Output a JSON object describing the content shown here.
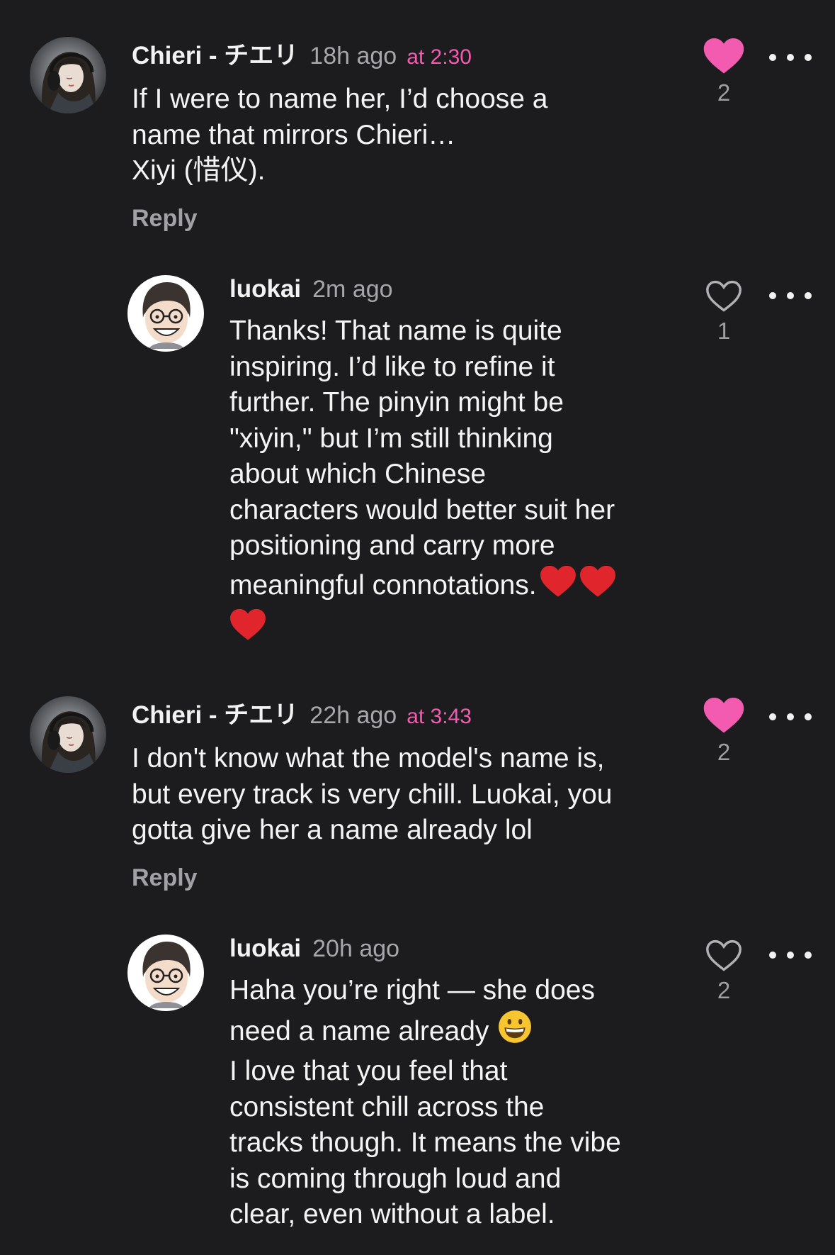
{
  "colors": {
    "background": "#1c1c1e",
    "accent_pink": "#f25bb0",
    "muted_text": "#a7a7ab"
  },
  "comments": [
    {
      "author": "Chieri - チエリ",
      "time": "18h ago",
      "timestamp_link": "at 2:30",
      "text": "If I were to name her, I’d choose a\nname that mirrors Chieri…\nXiyi (惜仪).",
      "reply_label": "Reply",
      "likes": "2",
      "liked": true,
      "avatar_icon": "headphones-girl-avatar-icon"
    },
    {
      "author": "luokai",
      "time": "2m ago",
      "text": "Thanks! That name is quite\ninspiring. I’d like to refine it\nfurther. The pinyin might be\n\"xiyin,\" but I’m still thinking\nabout which Chinese\ncharacters would better suit her\npositioning and carry more\nmeaningful connotations.",
      "likes": "1",
      "liked": false,
      "emoji": "red-heart-emoji",
      "avatar_icon": "cartoon-man-glasses-avatar-icon"
    },
    {
      "author": "Chieri - チエリ",
      "time": "22h ago",
      "timestamp_link": "at 3:43",
      "text": "I don't know what the model's name is,\nbut every track is very chill. Luokai, you\ngotta give her a name already lol",
      "reply_label": "Reply",
      "likes": "2",
      "liked": true,
      "avatar_icon": "headphones-girl-avatar-icon"
    },
    {
      "author": "luokai",
      "time": "20h ago",
      "text_line1": "Haha you’re right — she does",
      "text_line2": "need a name already",
      "text_rest": "I love that you feel that\nconsistent chill across the\ntracks though. It means the vibe\nis coming through loud and\nclear, even without a label.",
      "likes": "2",
      "liked": false,
      "emoji": "grinning-face-emoji",
      "avatar_icon": "cartoon-man-glasses-avatar-icon"
    }
  ]
}
